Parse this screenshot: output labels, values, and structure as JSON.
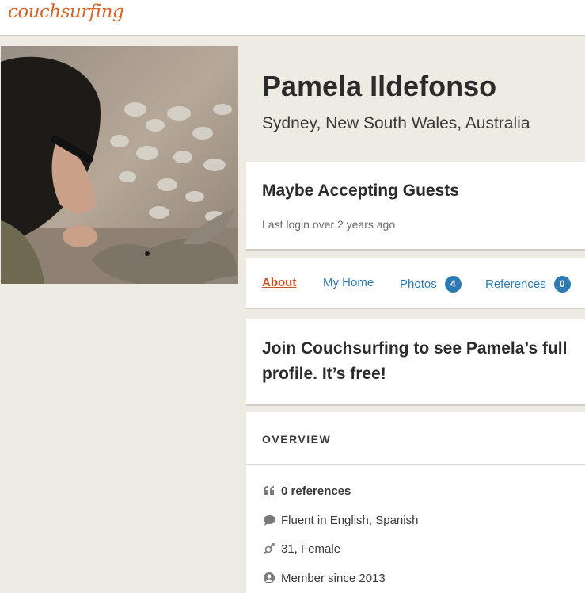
{
  "header": {
    "logo_text": "couchsurfing",
    "logo_color": "#d4652a"
  },
  "profile": {
    "name": "Pamela Ildefonso",
    "location": "Sydney, New South Wales, Australia",
    "photo_icon": "profile-photo"
  },
  "status": {
    "title": "Maybe Accepting Guests",
    "last_login": "Last login over 2 years ago"
  },
  "tabs": [
    {
      "label": "About",
      "active": true
    },
    {
      "label": "My Home"
    },
    {
      "label": "Photos",
      "count": "4"
    },
    {
      "label": "References",
      "count": "0"
    }
  ],
  "join": {
    "text": "Join Couchsurfing to see Pamela’s full profile. It’s free!"
  },
  "overview": {
    "title": "OVERVIEW",
    "items": [
      {
        "icon": "quote-icon",
        "text": "0 references"
      },
      {
        "icon": "speech-bubble-icon",
        "text": "Fluent in English, Spanish"
      },
      {
        "icon": "gender-icon",
        "text": "31, Female"
      },
      {
        "icon": "globe-user-icon",
        "text": "Member since 2013"
      }
    ]
  },
  "colors": {
    "accent": "#c5562a",
    "link": "#2d7bb4",
    "background": "#eeebe2"
  }
}
